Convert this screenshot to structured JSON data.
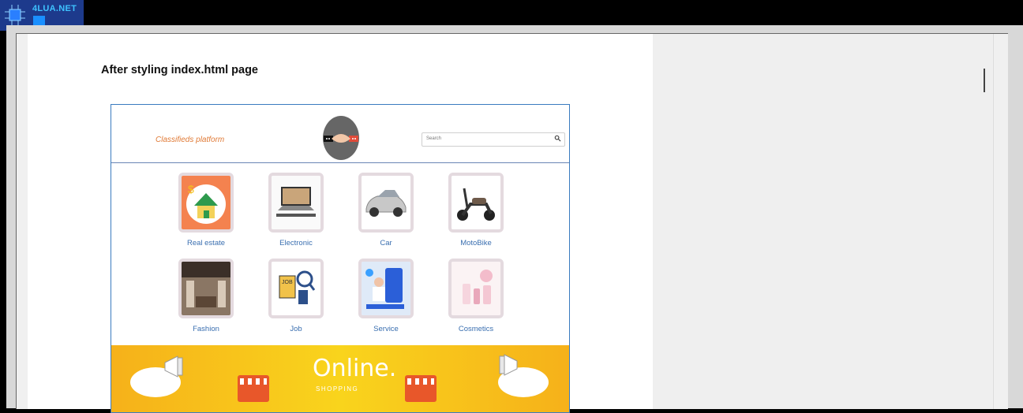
{
  "site_logo": {
    "name": "4LUA.NET"
  },
  "document": {
    "heading": "After styling index.html page"
  },
  "preview": {
    "brand": "Classifieds platform",
    "search_placeholder": "Search",
    "categories": [
      {
        "label": "Real estate",
        "icon": "house-icon"
      },
      {
        "label": "Electronic",
        "icon": "laptop-icon"
      },
      {
        "label": "Car",
        "icon": "car-icon"
      },
      {
        "label": "MotoBike",
        "icon": "scooter-icon"
      },
      {
        "label": "Fashion",
        "icon": "clothes-store-icon"
      },
      {
        "label": "Job",
        "icon": "job-search-icon"
      },
      {
        "label": "Service",
        "icon": "phone-service-icon"
      },
      {
        "label": "Cosmetics",
        "icon": "cosmetics-icon"
      }
    ],
    "banner": {
      "title": "Online.",
      "subtitle": "SHOPPING"
    }
  },
  "colors": {
    "brand_orange": "#e07a36",
    "link_blue": "#3a6fb0",
    "frame_blue": "#3a7bbf",
    "banner_yellow": "#f9d41c"
  }
}
